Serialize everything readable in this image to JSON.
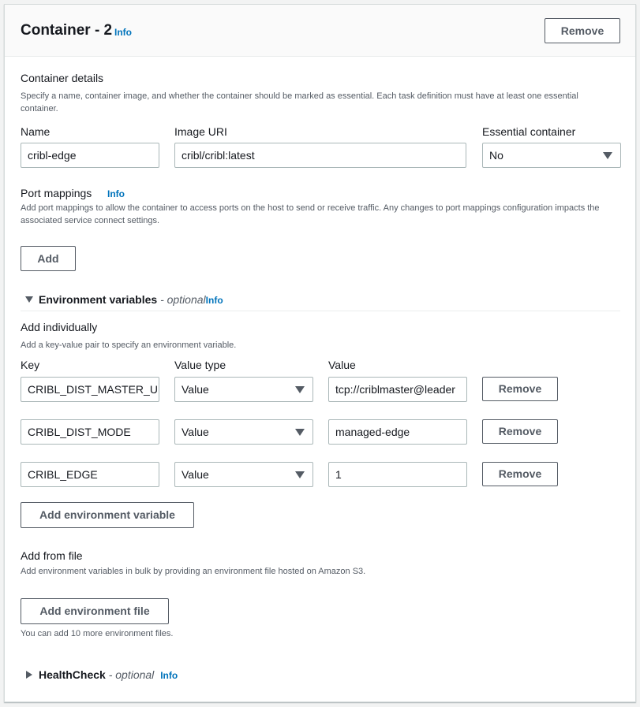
{
  "container": {
    "title": "Container - 2",
    "info": "Info",
    "remove_label": "Remove"
  },
  "details": {
    "title": "Container details",
    "description": "Specify a name, container image, and whether the container should be marked as essential. Each task definition must have at least one essential container.",
    "name_label": "Name",
    "name_value": "cribl-edge",
    "image_label": "Image URI",
    "image_value": "cribl/cribl:latest",
    "essential_label": "Essential container",
    "essential_value": "No"
  },
  "ports": {
    "title": "Port mappings",
    "info": "Info",
    "description": "Add port mappings to allow the container to access ports on the host to send or receive traffic. Any changes to port mappings configuration impacts the associated service connect settings.",
    "add_label": "Add"
  },
  "env": {
    "title": "Environment variables",
    "optional": "- optional",
    "info": "Info",
    "individually_title": "Add individually",
    "individually_desc": "Add a key-value pair to specify an environment variable.",
    "key_header": "Key",
    "type_header": "Value type",
    "value_header": "Value",
    "rows": [
      {
        "key": "CRIBL_DIST_MASTER_URL",
        "type": "Value",
        "value": "tcp://criblmaster@leader",
        "remove": "Remove"
      },
      {
        "key": "CRIBL_DIST_MODE",
        "type": "Value",
        "value": "managed-edge",
        "remove": "Remove"
      },
      {
        "key": "CRIBL_EDGE",
        "type": "Value",
        "value": "1",
        "remove": "Remove"
      }
    ],
    "add_var_label": "Add environment variable",
    "file_title": "Add from file",
    "file_desc": "Add environment variables in bulk by providing an environment file hosted on Amazon S3.",
    "add_file_label": "Add environment file",
    "file_hint": "You can add 10 more environment files."
  },
  "health": {
    "title": "HealthCheck",
    "optional": "- optional",
    "info": "Info"
  }
}
